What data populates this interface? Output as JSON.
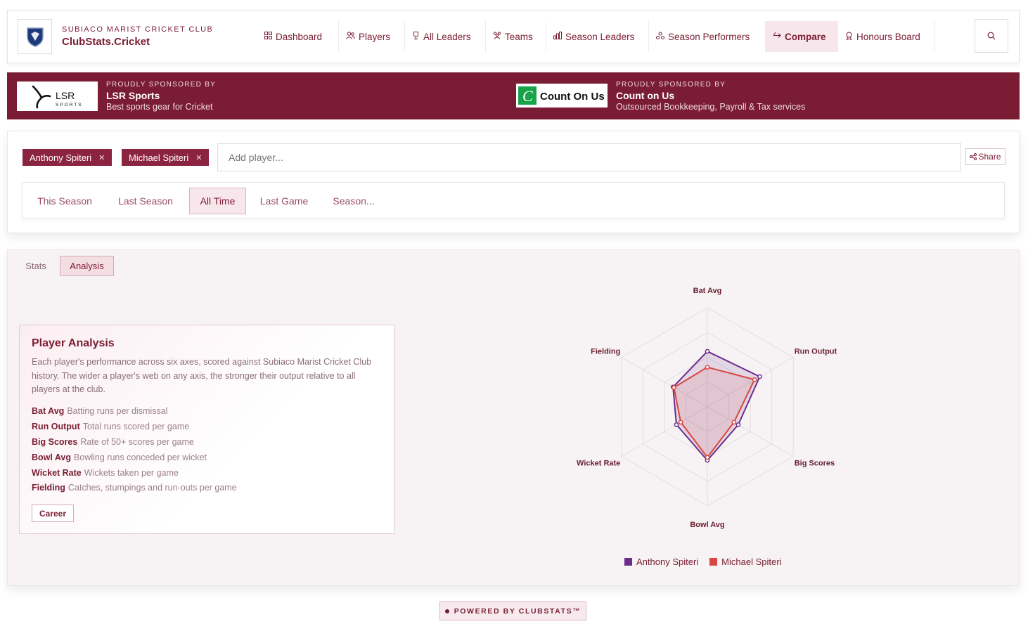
{
  "header": {
    "club_small": "SUBIACO MARIST CRICKET CLUB",
    "club_title": "ClubStats.Cricket",
    "nav": [
      {
        "label": "Dashboard",
        "icon": "grid-icon"
      },
      {
        "label": "Players",
        "icon": "users-icon"
      },
      {
        "label": "All Leaders",
        "icon": "trophy-icon"
      },
      {
        "label": "Teams",
        "icon": "team-icon"
      },
      {
        "label": "Season Leaders",
        "icon": "bar-chart-icon"
      },
      {
        "label": "Season Performers",
        "icon": "award-icon"
      },
      {
        "label": "Compare",
        "icon": "compare-icon",
        "active": true
      },
      {
        "label": "Honours Board",
        "icon": "medal-icon"
      }
    ]
  },
  "sponsors": [
    {
      "label": "PROUDLY SPONSORED BY",
      "name": "LSR Sports",
      "desc": "Best sports gear for Cricket",
      "logo_text": "LSR",
      "logo_sub": "SPORTS"
    },
    {
      "label": "PROUDLY SPONSORED BY",
      "name": "Count on Us",
      "desc": "Outsourced Bookkeeping, Payroll & Tax services",
      "logo_text": "Count On Us"
    }
  ],
  "compare": {
    "players": [
      "Anthony Spiteri",
      "Michael Spiteri"
    ],
    "add_placeholder": "Add player...",
    "share_label": "Share",
    "periods": [
      "This Season",
      "Last Season",
      "All Time",
      "Last Game",
      "Season..."
    ],
    "active_period": "All Time"
  },
  "analysis": {
    "tabs": [
      "Stats",
      "Analysis"
    ],
    "active_tab": "Analysis",
    "card_title": "Player Analysis",
    "card_desc": "Each player's performance across six axes, scored against Subiaco Marist Cricket Club history. The wider a player's web on any axis, the stronger their output relative to all players at the club.",
    "axes": [
      {
        "name": "Bat Avg",
        "desc": "Batting runs per dismissal"
      },
      {
        "name": "Run Output",
        "desc": "Total runs scored per game"
      },
      {
        "name": "Big Scores",
        "desc": "Rate of 50+ scores per game"
      },
      {
        "name": "Bowl Avg",
        "desc": "Bowling runs conceded per wicket"
      },
      {
        "name": "Wicket Rate",
        "desc": "Wickets taken per game"
      },
      {
        "name": "Fielding",
        "desc": "Catches, stumpings and run-outs per game"
      }
    ],
    "career_label": "Career"
  },
  "chart_data": {
    "type": "radar",
    "axes": [
      "Bat Avg",
      "Run Output",
      "Big Scores",
      "Bowl Avg",
      "Wicket Rate",
      "Fielding"
    ],
    "range": [
      0,
      1
    ],
    "series": [
      {
        "name": "Anthony Spiteri",
        "color": "#6b2d8c",
        "values": [
          0.56,
          0.61,
          0.36,
          0.54,
          0.36,
          0.4
        ]
      },
      {
        "name": "Michael Spiteri",
        "color": "#d9473f",
        "values": [
          0.4,
          0.55,
          0.31,
          0.51,
          0.31,
          0.39
        ]
      }
    ]
  },
  "footer": {
    "powered": "POWERED BY CLUBSTATS™"
  }
}
